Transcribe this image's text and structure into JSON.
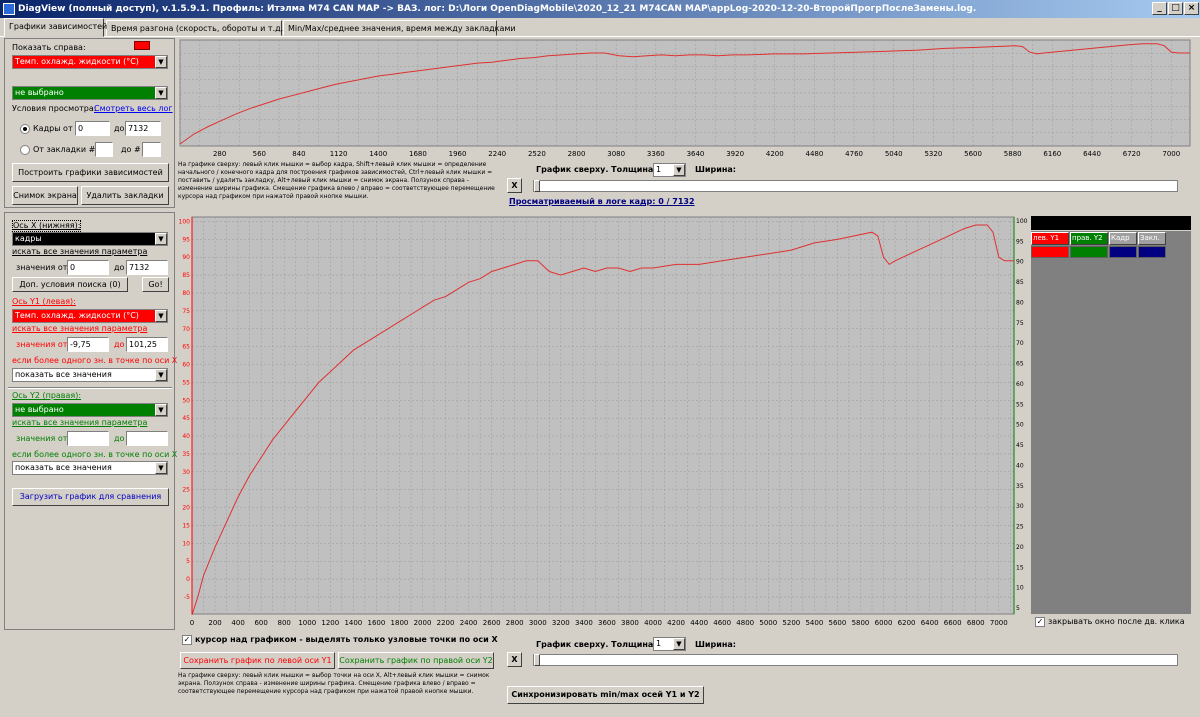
{
  "window": {
    "title": "DiagView (полный доступ), v.1.5.9.1. Профиль: Итэлма М74 CAN MAP -> ВАЗ.   лог: D:\\Логи OpenDiagMobile\\2020_12_21 M74CAN MAP\\appLog-2020-12-20-ВторойПрогрПослеЗамены.log.",
    "minimize": "_",
    "maximize": "□",
    "close": "×"
  },
  "tabs": [
    "Графики зависимостей",
    "Время разгона (скорость, обороты и т.д.)",
    "Min/Max/среднее значения, время между закладками"
  ],
  "top_left": {
    "show_right_label": "Показать справа:",
    "param1": "Темп. охлажд. жидкости (°C)",
    "param2": "не выбрано",
    "view_cond_label": "Условия просмотра:",
    "view_all_link": "Смотреть весь лог",
    "frames_from_label": "Кадры от",
    "frames_from": "0",
    "to_label": "до",
    "frames_to": "7132",
    "from_bookmark_label": "От закладки #",
    "to_hash_label": "до #",
    "build_button": "Построить графики зависимостей",
    "snapshot_button": "Снимок экрана",
    "delete_bookmarks_button": "Удалить закладки"
  },
  "top_help": "На графике сверху: левый клик мышки = выбор кадра, Shift+левый клик мышки = определение начального / конечного кадра для построения графиков зависимостей, Ctrl+левый клик мышки = поставить / удалить закладку, Alt+левый клик мышки = снимок экрана. Ползунок справа - изменение ширины графика. Смещение графика влево / вправо = соответствующее перемещение курсора над графиком при нажатой правой кнопке мышки.",
  "top_controls": {
    "x_button": "X",
    "thickness_label": "График сверху. Толщина:",
    "thickness": "1",
    "width_label": "Ширина:",
    "viewed_frame": "Просматриваемый в логе кадр: 0 / 7132"
  },
  "bottom_left": {
    "axis_x_label": "Ось X (нижняя):",
    "axis_x_param": "кадры",
    "search_all_label": "искать все значения параметра",
    "values_from_label": "значения от",
    "x_from": "0",
    "to_label": "до",
    "x_to": "7132",
    "extra_search_button": "Доп. условия поиска (0)",
    "go_button": "Go!",
    "axis_y1_label": "Ось Y1 (левая):",
    "y1_param": "Темп. охлажд. жидкости (°C)",
    "y1_from": "-9,75",
    "y1_to": "101,25",
    "multi_label": "если более одного зн. в точке по оси X:",
    "y1_mode": "показать все значения",
    "axis_y2_label": "Ось Y2 (правая):",
    "y2_param": "не выбрано",
    "y2_from": "",
    "y2_to": "",
    "y2_mode": "показать все значения",
    "load_compare_button": "Загрузить график для сравнения"
  },
  "bottom_controls": {
    "cursor_checkbox_label": "курсор над графиком - выделять только узловые точки по оси X",
    "save_y1_button": "Сохранить график по левой оси Y1",
    "save_y2_button": "Сохранить график по правой оси Y2",
    "x_button": "X",
    "thickness_label": "График сверху. Толщина:",
    "thickness": "1",
    "width_label": "Ширина:",
    "help": "На графике сверху: левый клик мышки = выбор точки на оси X, Alt+левый клик мышки = снимок экрана. Ползунок справа - изменение ширины графика. Смещение графика влево / вправо = соответствующее перемещение курсора над графиком при нажатой правой кнопке мышки.",
    "sync_button": "Синхронизировать min/max осей Y1 и Y2"
  },
  "legend": {
    "headers": [
      "лев. Y1",
      "прав. Y2",
      "Кадр",
      "Закл."
    ],
    "close_after_label": "закрывать окно после дв. клика"
  },
  "colors": {
    "line": "#e03030",
    "y1": "#ff0000",
    "y2": "#008000",
    "plot_bg": "#c0c0c0",
    "grid": "#9a9a9a",
    "title_blue": "#0a246a"
  },
  "chart_data": [
    {
      "type": "line",
      "title": "",
      "xlabel": "",
      "ylabel": "",
      "xlim": [
        0,
        7132
      ],
      "xticks": [
        280,
        560,
        840,
        1120,
        1400,
        1680,
        1960,
        2240,
        2520,
        2800,
        3080,
        3360,
        3640,
        3920,
        4200,
        4480,
        4760,
        5040,
        5320,
        5600,
        5880,
        6160,
        6440,
        6720,
        7000
      ],
      "ylim": [
        -10,
        101
      ],
      "grid": true,
      "series": [
        {
          "x": [
            0,
            100,
            200,
            300,
            400,
            500,
            600,
            700,
            800,
            900,
            1000,
            1100,
            1200,
            1300,
            1400,
            1500,
            1600,
            1700,
            1800,
            1900,
            2000,
            2100,
            2200,
            2300,
            2400,
            2500,
            2600,
            2700,
            2800,
            2900,
            3000,
            3100,
            3200,
            3300,
            3400,
            3500,
            3600,
            3700,
            3800,
            3900,
            4000,
            4200,
            4400,
            4600,
            4800,
            5000,
            5200,
            5400,
            5600,
            5750,
            5900,
            5950,
            6000,
            6050,
            6100,
            6300,
            6500,
            6700,
            6800,
            6900,
            6950,
            7000,
            7050,
            7100,
            7132
          ],
          "y": [
            -10,
            1,
            9,
            16,
            23,
            29,
            34,
            39,
            43,
            47,
            51,
            55,
            58,
            61,
            64,
            66,
            68,
            70,
            72,
            74,
            76,
            78,
            79,
            81,
            83,
            84,
            86,
            87,
            88,
            89,
            89,
            86,
            85,
            86,
            87,
            86,
            87,
            87,
            86,
            87,
            87,
            88,
            88,
            89,
            90,
            91,
            92,
            94,
            95,
            96,
            97,
            96,
            90,
            88,
            89,
            92,
            95,
            98,
            99,
            99,
            97,
            90,
            89,
            89,
            89
          ]
        }
      ]
    },
    {
      "type": "line",
      "title": "",
      "xlabel": "",
      "ylabel": "",
      "xlim": [
        0,
        7132
      ],
      "xticks": [
        0,
        200,
        400,
        600,
        800,
        1000,
        1200,
        1400,
        1600,
        1800,
        2000,
        2200,
        2400,
        2600,
        2800,
        3000,
        3200,
        3400,
        3600,
        3800,
        4000,
        4200,
        4400,
        4600,
        4800,
        5000,
        5200,
        5400,
        5600,
        5800,
        6000,
        6200,
        6400,
        6600,
        6800,
        7000
      ],
      "ylim": [
        -9.75,
        101.25
      ],
      "yticks_left": [
        -5,
        0,
        5,
        10,
        15,
        20,
        25,
        30,
        35,
        40,
        45,
        50,
        55,
        60,
        65,
        70,
        75,
        80,
        85,
        90,
        95,
        100
      ],
      "yticks_right": [
        5,
        10,
        15,
        20,
        25,
        30,
        35,
        40,
        45,
        50,
        55,
        60,
        65,
        70,
        75,
        80,
        85,
        90,
        95,
        100
      ],
      "grid": true,
      "series": [
        {
          "x": [
            0,
            50,
            100,
            200,
            300,
            400,
            500,
            600,
            700,
            800,
            900,
            1000,
            1100,
            1200,
            1300,
            1400,
            1500,
            1600,
            1700,
            1800,
            1900,
            2000,
            2100,
            2200,
            2300,
            2400,
            2500,
            2600,
            2700,
            2800,
            2900,
            3000,
            3100,
            3200,
            3300,
            3400,
            3500,
            3600,
            3700,
            3800,
            3900,
            4000,
            4200,
            4400,
            4600,
            4800,
            5000,
            5200,
            5400,
            5600,
            5750,
            5900,
            5950,
            6000,
            6050,
            6100,
            6300,
            6500,
            6700,
            6800,
            6900,
            6950,
            7000,
            7050,
            7100,
            7132
          ],
          "y": [
            -10,
            -5,
            1,
            9,
            16,
            23,
            29,
            34,
            39,
            43,
            47,
            51,
            55,
            58,
            61,
            64,
            66,
            68,
            70,
            72,
            74,
            76,
            78,
            79,
            81,
            83,
            84,
            86,
            87,
            88,
            89,
            89,
            86,
            85,
            86,
            87,
            86,
            87,
            87,
            86,
            87,
            87,
            88,
            88,
            89,
            90,
            91,
            92,
            94,
            95,
            96,
            97,
            96,
            90,
            88,
            89,
            92,
            95,
            98,
            99,
            99,
            97,
            90,
            89,
            89,
            89
          ]
        }
      ]
    }
  ]
}
